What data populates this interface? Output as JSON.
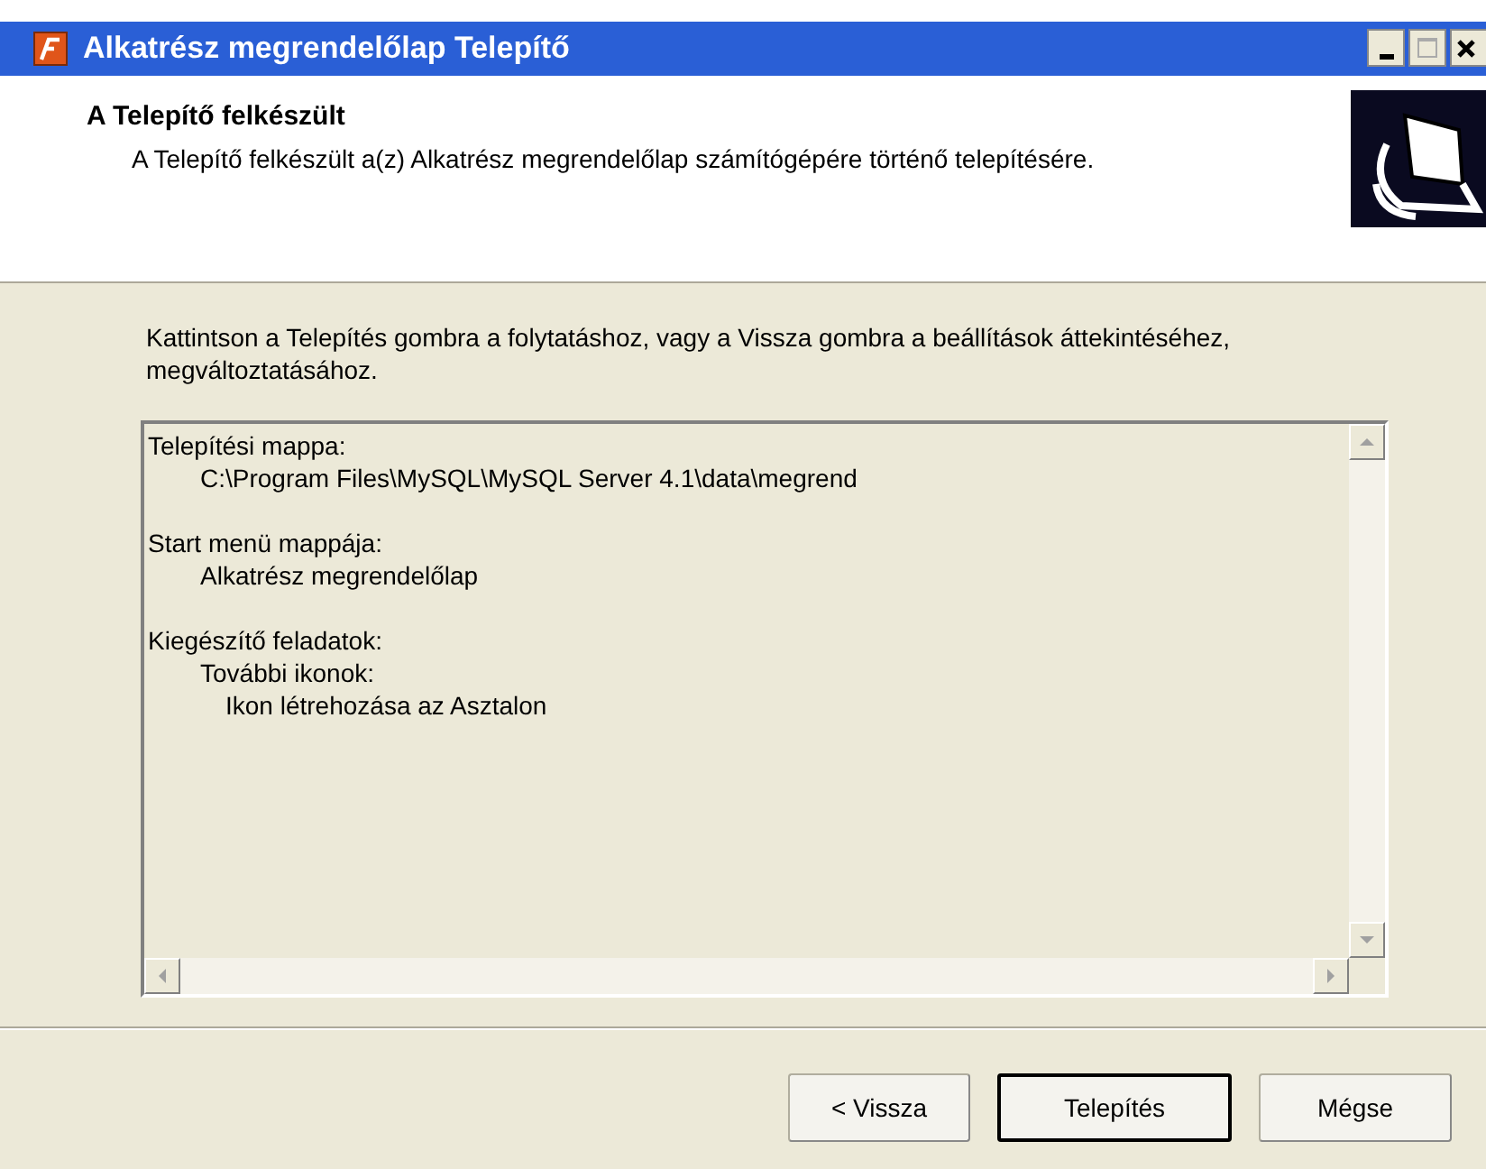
{
  "window": {
    "title": "Alkatrész megrendelőlap Telepítő"
  },
  "header": {
    "title": "A Telepítő felkészült",
    "subtitle": "A Telepítő felkészült a(z) Alkatrész megrendelőlap számítógépére történő telepítésére."
  },
  "instruction": "Kattintson a Telepítés gombra a folytatáshoz, vagy a Vissza gombra a beállítások áttekintéséhez, megváltoztatásához.",
  "summary": [
    {
      "text": "Telepítési mappa:",
      "children": [
        {
          "text": "C:\\Program Files\\MySQL\\MySQL Server 4.1\\data\\megrend"
        }
      ]
    },
    {
      "text": "Start menü mappája:",
      "children": [
        {
          "text": "Alkatrész megrendelőlap"
        }
      ]
    },
    {
      "text": "Kiegészítő feladatok:",
      "children": [
        {
          "text": "További ikonok:",
          "children": [
            {
              "text": "Ikon létrehozása az Asztalon"
            }
          ]
        }
      ]
    }
  ],
  "buttons": [
    {
      "label": "< Vissza",
      "default": false
    },
    {
      "label": "Telepítés",
      "default": true
    },
    {
      "label": "Mégse",
      "default": false
    }
  ]
}
